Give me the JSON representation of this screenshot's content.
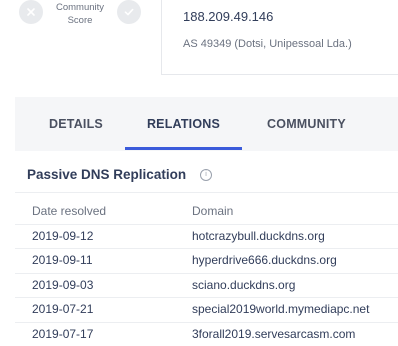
{
  "community_score": {
    "label": "Community Score",
    "dislike_icon": "close-icon",
    "like_icon": "check-icon"
  },
  "ip_card": {
    "address": "188.209.49.146",
    "as_info": "AS 49349 (Dotsi, Unipessoal Lda.)"
  },
  "tabs": [
    {
      "label": "DETAILS",
      "active": false
    },
    {
      "label": "RELATIONS",
      "active": true
    },
    {
      "label": "COMMUNITY",
      "active": false
    }
  ],
  "accent_color": "#3b5bdb",
  "section": {
    "title": "Passive DNS Replication",
    "info_icon": "info-icon"
  },
  "dns_table": {
    "headers": [
      "Date resolved",
      "Domain"
    ],
    "rows": [
      {
        "date": "2019-09-12",
        "domain": "hotcrazybull.duckdns.org"
      },
      {
        "date": "2019-09-11",
        "domain": "hyperdrive666.duckdns.org"
      },
      {
        "date": "2019-09-03",
        "domain": "sciano.duckdns.org"
      },
      {
        "date": "2019-07-21",
        "domain": "special2019world.mymediapc.net"
      },
      {
        "date": "2019-07-17",
        "domain": "3forall2019.servesarcasm.com"
      }
    ]
  }
}
